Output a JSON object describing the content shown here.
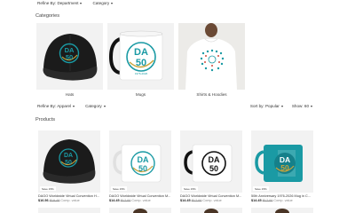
{
  "top_filters": {
    "refine": "Refine By: Department",
    "category": "Category"
  },
  "sections": {
    "categories": "Categories",
    "products": "Products"
  },
  "categories": [
    {
      "label": "Hats"
    },
    {
      "label": "Mugs"
    },
    {
      "label": "Shirts & Hoodies"
    }
  ],
  "mid_filters": {
    "refine": "Refine By: Apparel",
    "category": "Category"
  },
  "sort": {
    "sort_by": "Sort by: Popular",
    "show": "Show: 60"
  },
  "logo": {
    "line1": "DA",
    "line2": "50",
    "years": "1976-2026"
  },
  "products": [
    {
      "tag": "Save 15%",
      "title": "DAGO Worldwide Virtual Convention H...",
      "price": "$16.56",
      "was": "$19.48",
      "note": "Comp. value"
    },
    {
      "tag": "Save 15%",
      "title": "DAGO Worldwide Virtual Convention M...",
      "price": "$14.45",
      "was": "$17.00",
      "note": "Comp. value"
    },
    {
      "tag": "Save 15%",
      "title": "DAGO Worldwide Virtual Convention M...",
      "price": "$14.45",
      "was": "$17.00",
      "note": "Comp. value"
    },
    {
      "tag": "Save 15%",
      "title": "50th Anniversary 1976-2026 Mug in C...",
      "price": "$14.45",
      "was": "$17.00",
      "note": "Comp. value"
    }
  ],
  "colors": {
    "teal": "#1a9aa4",
    "cap": "#1b1b1b",
    "gold": "#c8a33a"
  }
}
